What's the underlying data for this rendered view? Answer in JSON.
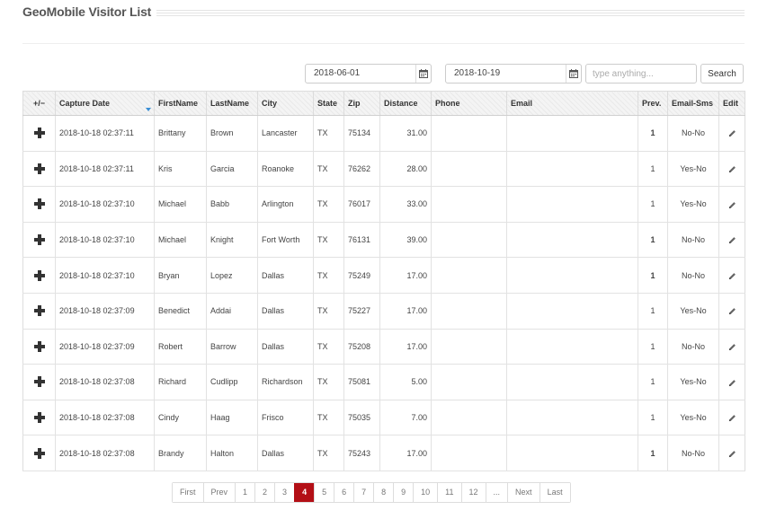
{
  "header": {
    "title": "GeoMobile Visitor List"
  },
  "filters": {
    "date_from": "2018-06-01",
    "date_to": "2018-10-19",
    "search_placeholder": "type anything...",
    "search_label": "Search"
  },
  "table": {
    "columns": [
      "+/−",
      "Capture Date",
      "FirstName",
      "LastName",
      "City",
      "State",
      "Zip",
      "Distance",
      "Phone",
      "Email",
      "Prev.",
      "Email-Sms",
      "Edit"
    ],
    "rows": [
      {
        "date": "2018-10-18 02:37:11",
        "first": "Brittany",
        "last": "Brown",
        "city": "Lancaster",
        "state": "TX",
        "zip": "75134",
        "distance": "31.00",
        "phone": "",
        "email": "",
        "prev": "1",
        "prev_bold": true,
        "sms": "No-No"
      },
      {
        "date": "2018-10-18 02:37:11",
        "first": "Kris",
        "last": "Garcia",
        "city": "Roanoke",
        "state": "TX",
        "zip": "76262",
        "distance": "28.00",
        "phone": "",
        "email": "",
        "prev": "1",
        "prev_bold": false,
        "sms": "Yes-No"
      },
      {
        "date": "2018-10-18 02:37:10",
        "first": "Michael",
        "last": "Babb",
        "city": "Arlington",
        "state": "TX",
        "zip": "76017",
        "distance": "33.00",
        "phone": "",
        "email": "",
        "prev": "1",
        "prev_bold": false,
        "sms": "Yes-No"
      },
      {
        "date": "2018-10-18 02:37:10",
        "first": "Michael",
        "last": "Knight",
        "city": "Fort Worth",
        "state": "TX",
        "zip": "76131",
        "distance": "39.00",
        "phone": "",
        "email": "",
        "prev": "1",
        "prev_bold": true,
        "sms": "No-No"
      },
      {
        "date": "2018-10-18 02:37:10",
        "first": "Bryan",
        "last": "Lopez",
        "city": "Dallas",
        "state": "TX",
        "zip": "75249",
        "distance": "17.00",
        "phone": "",
        "email": "",
        "prev": "1",
        "prev_bold": true,
        "sms": "No-No"
      },
      {
        "date": "2018-10-18 02:37:09",
        "first": "Benedict",
        "last": "Addai",
        "city": "Dallas",
        "state": "TX",
        "zip": "75227",
        "distance": "17.00",
        "phone": "",
        "email": "",
        "prev": "1",
        "prev_bold": false,
        "sms": "Yes-No"
      },
      {
        "date": "2018-10-18 02:37:09",
        "first": "Robert",
        "last": "Barrow",
        "city": "Dallas",
        "state": "TX",
        "zip": "75208",
        "distance": "17.00",
        "phone": "",
        "email": "",
        "prev": "1",
        "prev_bold": false,
        "sms": "No-No"
      },
      {
        "date": "2018-10-18 02:37:08",
        "first": "Richard",
        "last": "Cudlipp",
        "city": "Richardson",
        "state": "TX",
        "zip": "75081",
        "distance": "5.00",
        "phone": "",
        "email": "",
        "prev": "1",
        "prev_bold": false,
        "sms": "Yes-No"
      },
      {
        "date": "2018-10-18 02:37:08",
        "first": "Cindy",
        "last": "Haag",
        "city": "Frisco",
        "state": "TX",
        "zip": "75035",
        "distance": "7.00",
        "phone": "",
        "email": "",
        "prev": "1",
        "prev_bold": false,
        "sms": "Yes-No"
      },
      {
        "date": "2018-10-18 02:37:08",
        "first": "Brandy",
        "last": "Halton",
        "city": "Dallas",
        "state": "TX",
        "zip": "75243",
        "distance": "17.00",
        "phone": "",
        "email": "",
        "prev": "1",
        "prev_bold": true,
        "sms": "No-No"
      }
    ]
  },
  "pagination": {
    "pages": [
      "First",
      "Prev",
      "1",
      "2",
      "3",
      "4",
      "5",
      "6",
      "7",
      "8",
      "9",
      "10",
      "11",
      "12",
      "...",
      "Next",
      "Last"
    ],
    "active": "4",
    "accent_color": "#b30f16"
  }
}
